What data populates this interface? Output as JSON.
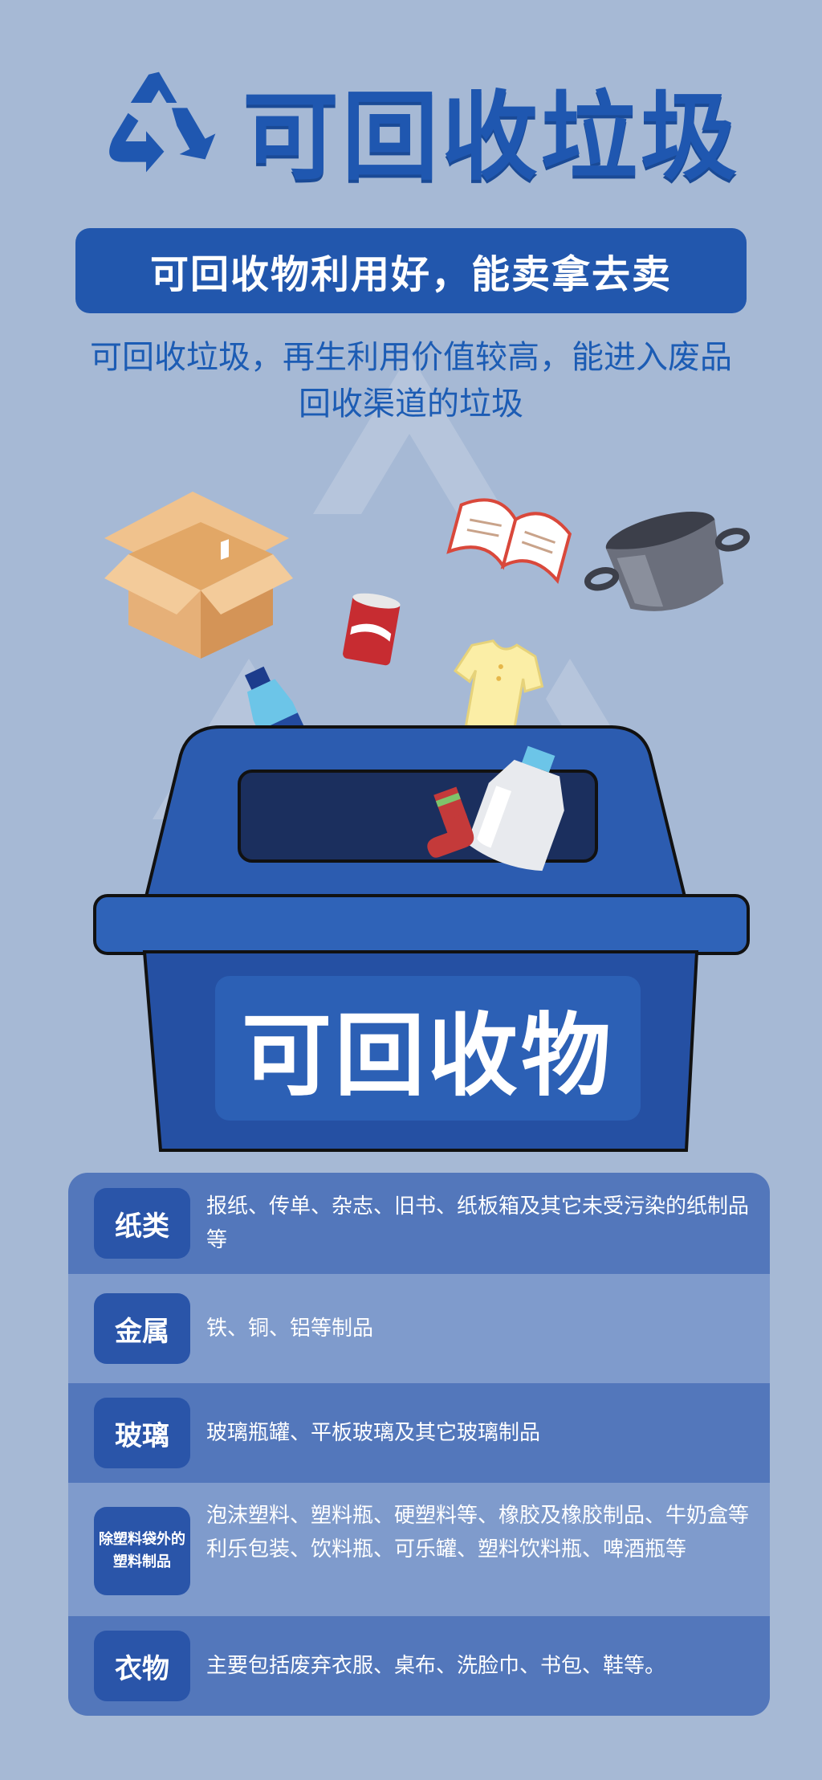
{
  "title": "可回收垃圾",
  "subtitle": "可回收物利用好，能卖拿去卖",
  "intro": "可回收垃圾，再生利用价值较高，能进入废品回收渠道的垃圾",
  "bin_label": "可回收物",
  "categories": [
    {
      "name": "纸类",
      "desc": "报纸、传单、杂志、旧书、纸板箱及其它未受污染的纸制品等"
    },
    {
      "name": "金属",
      "desc": "铁、铜、铝等制品"
    },
    {
      "name": "玻璃",
      "desc": "玻璃瓶罐、平板玻璃及其它玻璃制品"
    },
    {
      "name": "除塑料袋外的塑料制品",
      "desc": "泡沫塑料、塑料瓶、硬塑料等、橡胶及橡胶制品、牛奶盒等利乐包装、饮料瓶、可乐罐、塑料饮料瓶、啤酒瓶等"
    },
    {
      "name": "衣物",
      "desc": "主要包括废弃衣服、桌布、洗脸巾、书包、鞋等。"
    }
  ],
  "colors": {
    "background": "#a6b9d5",
    "primary_blue": "#2257ad",
    "title_blue": "#1f57b0",
    "row_dark": "#5377bb",
    "row_light": "#7f9bcc"
  },
  "icons": [
    "recycle-icon",
    "cardboard-box-icon",
    "book-icon",
    "pot-icon",
    "can-icon",
    "tshirt-icon",
    "water-bottle-icon",
    "detergent-bottle-icon",
    "sock-icon",
    "recycle-bin-icon"
  ]
}
